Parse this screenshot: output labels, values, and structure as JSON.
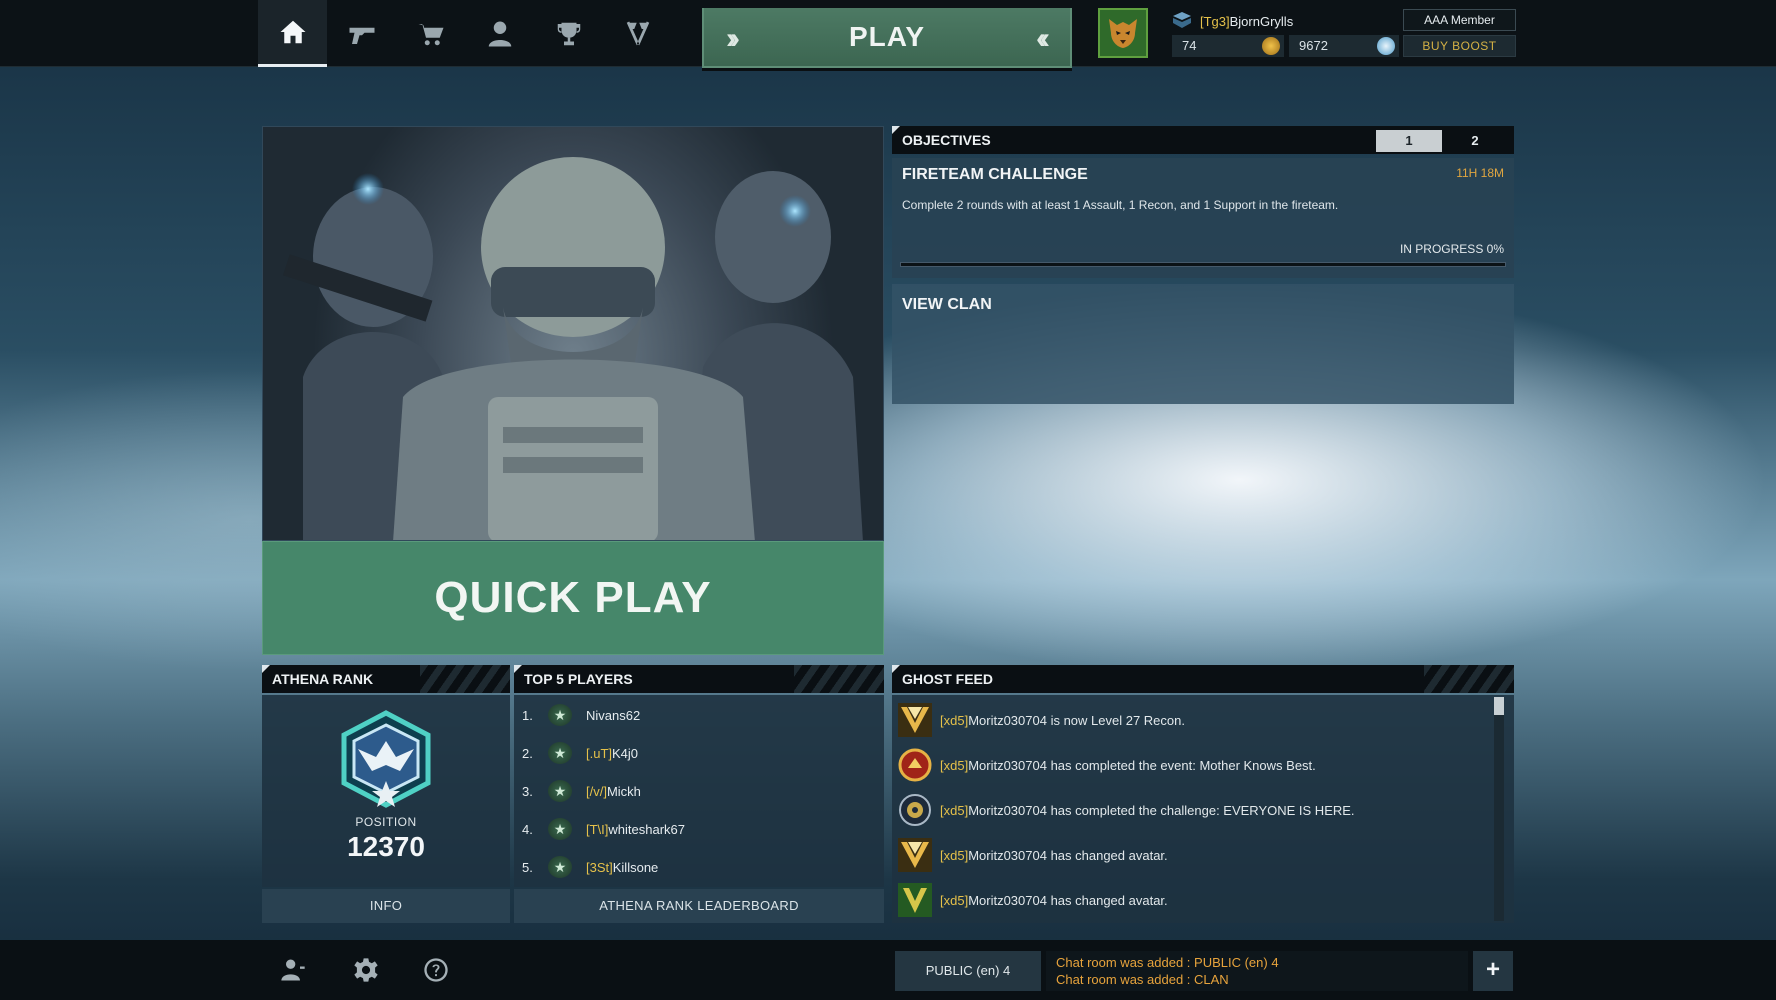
{
  "nav": {
    "items": [
      {
        "name": "home",
        "icon": "home-icon"
      },
      {
        "name": "weapons",
        "icon": "pistol-icon"
      },
      {
        "name": "store",
        "icon": "cart-icon"
      },
      {
        "name": "profile",
        "icon": "user-icon"
      },
      {
        "name": "achievements",
        "icon": "trophy-icon"
      },
      {
        "name": "matches",
        "icon": "crossed-flags-icon"
      }
    ],
    "active": "home"
  },
  "play_button": {
    "label": "PLAY"
  },
  "player": {
    "clan_tag": "[Tg3]",
    "name": "BjornGrylls",
    "membership": "AAA Member",
    "credits": "74",
    "ghost_coins": "9672",
    "buy_boost_label": "BUY BOOST"
  },
  "quick_play": {
    "label": "QUICK PLAY"
  },
  "objectives": {
    "title": "OBJECTIVES",
    "tabs": [
      "1",
      "2"
    ],
    "active_tab": "1",
    "challenge": {
      "title": "FIRETEAM CHALLENGE",
      "time_left": "11H 18M",
      "description": "Complete 2 rounds with at least 1 Assault, 1 Recon, and 1 Support in the fireteam.",
      "status": "IN PROGRESS 0%",
      "progress_fraction": 0
    },
    "view_clan_label": "VIEW CLAN"
  },
  "athena_rank": {
    "title": "ATHENA RANK",
    "position_label": "POSITION",
    "position_value": "12370",
    "info_label": "INFO"
  },
  "top_players": {
    "title": "TOP 5 PLAYERS",
    "players": [
      {
        "num": "1.",
        "tag": "",
        "name": "Nivans62"
      },
      {
        "num": "2.",
        "tag": "[.uT]",
        "name": "K4j0"
      },
      {
        "num": "3.",
        "tag": "[/v/]",
        "name": "Mickh"
      },
      {
        "num": "4.",
        "tag": "[T\\I]",
        "name": "whiteshark67"
      },
      {
        "num": "5.",
        "tag": "[3St]",
        "name": "Killsone"
      }
    ],
    "leaderboard_label": "ATHENA RANK LEADERBOARD"
  },
  "ghost_feed": {
    "title": "GHOST FEED",
    "entries": [
      {
        "tag": "[xd5]",
        "text": "Moritz030704 is now Level 27 Recon.",
        "icon": "recon-rank-icon"
      },
      {
        "tag": "[xd5]",
        "text": "Moritz030704 has completed the event: Mother Knows Best.",
        "icon": "event-medal-icon"
      },
      {
        "tag": "[xd5]",
        "text": "Moritz030704 has completed the challenge: EVERYONE IS HERE.",
        "icon": "challenge-badge-icon"
      },
      {
        "tag": "[xd5]",
        "text": "Moritz030704 has changed avatar.",
        "icon": "recon-rank-icon"
      },
      {
        "tag": "[xd5]",
        "text": "Moritz030704 has changed avatar.",
        "icon": "avatar-emblem-icon"
      }
    ]
  },
  "chat": {
    "room_label": "PUBLIC (en) 4",
    "messages": [
      "Chat room was added : PUBLIC (en) 4",
      "Chat room was added : CLAN"
    ],
    "add_label": "+"
  },
  "bottom_icons": [
    "friends-icon",
    "gear-icon",
    "help-icon"
  ],
  "colors": {
    "accent_green": "#46876a",
    "clan_tag_yellow": "#e5c14a",
    "chat_orange": "#e7a33c",
    "timer_orange": "#e0a640"
  }
}
